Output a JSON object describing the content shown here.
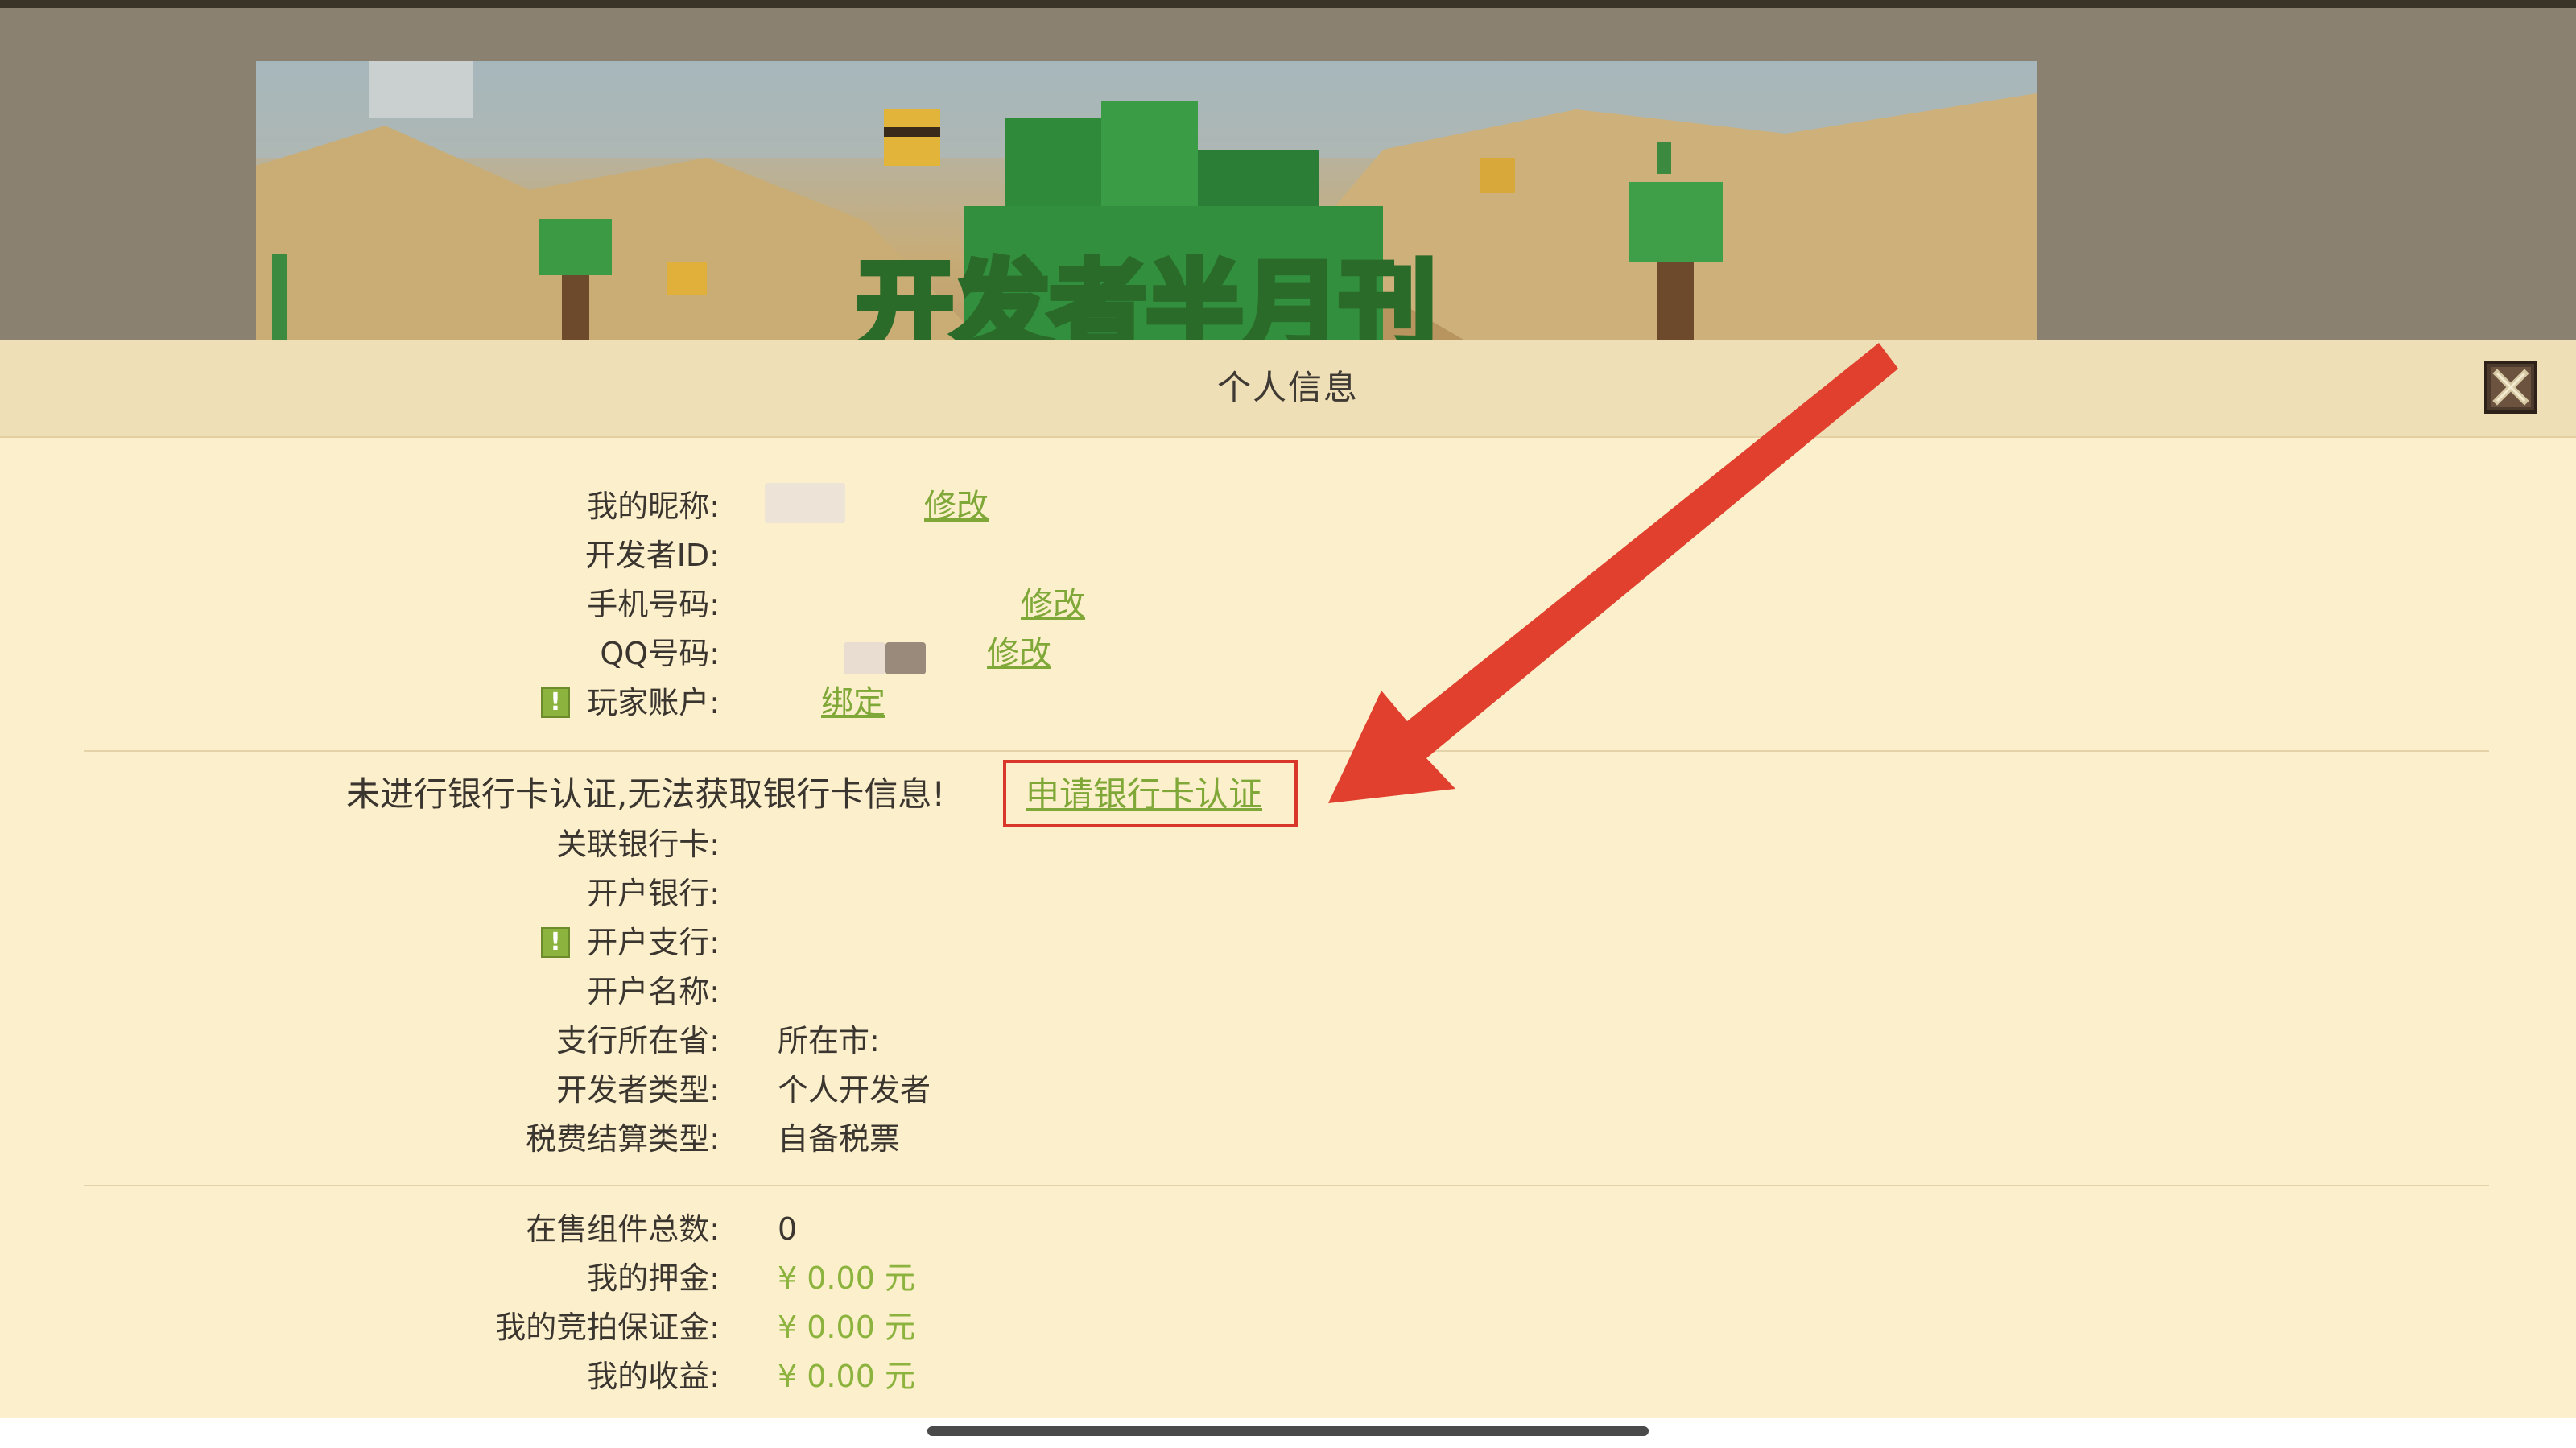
{
  "banner": {
    "text": "开发者半月刊"
  },
  "modal": {
    "title": "个人信息",
    "close_icon": "close-icon",
    "profile": {
      "nickname_label": "我的昵称:",
      "nickname_edit": "修改",
      "developer_id_label": "开发者ID:",
      "phone_label": "手机号码:",
      "phone_edit": "修改",
      "qq_label": "QQ号码:",
      "qq_edit": "修改",
      "player_account_label": "玩家账户:",
      "player_account_bind": "绑定",
      "warning_mark": "!"
    },
    "bank": {
      "notice": "未进行银行卡认证,无法获取银行卡信息!",
      "apply_link": "申请银行卡认证",
      "linked_card_label": "关联银行卡:",
      "bank_label": "开户银行:",
      "branch_label": "开户支行:",
      "account_name_label": "开户名称:",
      "province_label": "支行所在省:",
      "city_label": "所在市:",
      "dev_type_label": "开发者类型:",
      "dev_type_value": "个人开发者",
      "tax_type_label": "税费结算类型:",
      "tax_type_value": "自备税票"
    },
    "stats": {
      "items_on_sale_label": "在售组件总数:",
      "items_on_sale_value": "0",
      "deposit_label": "我的押金:",
      "deposit_value": "¥ 0.00 元",
      "auction_deposit_label": "我的竞拍保证金:",
      "auction_deposit_value": "¥ 0.00 元",
      "earnings_label": "我的收益:",
      "earnings_value": "¥ 0.00 元"
    },
    "colors": {
      "accent_green": "#8cb33e",
      "annotation_red": "#e0402d",
      "panel_bg": "#fcefcb"
    }
  }
}
